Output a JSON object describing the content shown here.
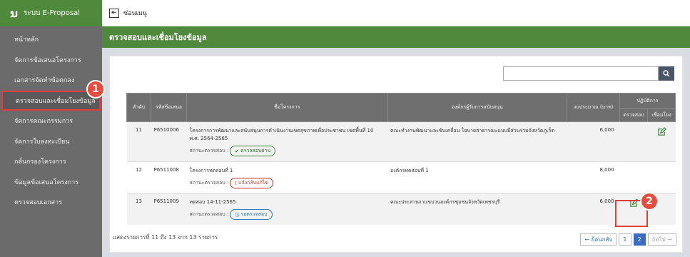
{
  "sidebar": {
    "logo": "ນ",
    "app_name": "ระบบ E-Proposal",
    "items": [
      {
        "label": "หน้าหลัก"
      },
      {
        "label": "จัดการข้อเสนอโครงการ"
      },
      {
        "label": "เอกสารจัดทำข้อตกลง"
      },
      {
        "label": "ตรวจสอบและเชื่อมโยงข้อมูล"
      },
      {
        "label": "จัดการคณะกรรมการ"
      },
      {
        "label": "จัดการใบลงทะเบียน"
      },
      {
        "label": "กลั่นกรองโครงการ"
      },
      {
        "label": "ข้อมูลข้อเสนอโครงการ"
      },
      {
        "label": "ตรวจสอบเอกสาร"
      }
    ]
  },
  "topbar": {
    "hide_menu": "ซ่อนเมนู"
  },
  "page": {
    "title": "ตรวจสอบและเชื่อมโยงข้อมูล"
  },
  "search": {
    "placeholder": "",
    "button_icon": "search-icon"
  },
  "table": {
    "headers": {
      "index": "ลำดับ",
      "code": "รหัสข้อเสนอ",
      "project": "ชื่อโครงการ",
      "org": "องค์กรผู้รับการสนับสนุน",
      "budget": "งบประมาณ (บาท)",
      "actions": "ปฏิบัติการ",
      "check": "ตรวจสอบ",
      "link": "เชื่อมโยง"
    },
    "status_label": "สถานะตรวจสอบ :",
    "rows": [
      {
        "index": "11",
        "code": "P6510006",
        "project": "โครงการการพัฒนาและสนับสนุนการดำเนินงานเขตสุขภาพเพื่อประชาชน เขตพื้นที่ 10 พ.ศ. 2564-2565",
        "status": "ตรวจสอบผ่าน",
        "org": "คณะทำงานพัฒนาและขับเคลื่อน โยบายสาธารณะแบบมีส่วนร่วมจังหวัดภูเก็ต",
        "budget": "6,000"
      },
      {
        "index": "12",
        "code": "P6511008",
        "project": "โครงการทดสอบที่ 1",
        "status": "แจ้งกลับแก้ไข",
        "org": "องค์กรทดสอบที่ 1",
        "budget": "8,000"
      },
      {
        "index": "13",
        "code": "P6511009",
        "project": "ทดสอบ 14-11-2565",
        "status": "รอตรวจสอบ",
        "org": "คณะประสานงานขบวนองค์กรชุมชนจังหวัดเพชรบุรี",
        "budget": "6,000"
      }
    ]
  },
  "footer": {
    "info": "แสดงรายการที่ 11 ถึง 13 จาก 13 รายการ",
    "prev": "← ย้อนกลับ",
    "pages": [
      "1",
      "2"
    ],
    "next": "ถัดไป →"
  },
  "annotations": {
    "one": "1",
    "two": "2"
  },
  "colors": {
    "brand_green": "#4f8a3c",
    "sidebar_gray": "#6b6b6b",
    "highlight_red": "#e23b3b"
  }
}
